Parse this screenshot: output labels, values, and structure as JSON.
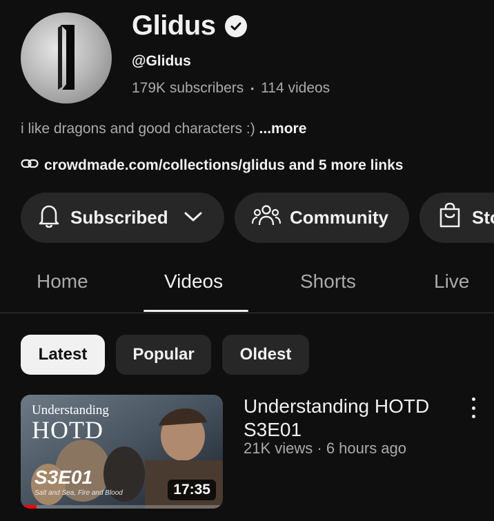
{
  "channel": {
    "name": "Glidus",
    "handle": "@Glidus",
    "subscribers": "179K subscribers",
    "separator": "•",
    "videos": "114 videos",
    "bio": "i like dragons and good characters :) ",
    "more": "...more",
    "links": "crowdmade.com/collections/glidus and 5 more links",
    "verified": true
  },
  "actions": {
    "subscribed": "Subscribed",
    "community": "Community",
    "store": "Store"
  },
  "tabs": [
    {
      "label": "Home",
      "active": false
    },
    {
      "label": "Videos",
      "active": true
    },
    {
      "label": "Shorts",
      "active": false
    },
    {
      "label": "Live",
      "active": false
    }
  ],
  "chips": [
    {
      "label": "Latest",
      "active": true
    },
    {
      "label": "Popular",
      "active": false
    },
    {
      "label": "Oldest",
      "active": false
    }
  ],
  "video": {
    "title": "Understanding HOTD S3E01",
    "meta": "21K views · 6 hours ago",
    "duration": "17:35",
    "watch_progress": 0.08,
    "thumb": {
      "top_text": "Understanding",
      "big_text": "HOTD",
      "episode": "S3E01",
      "caption": "Salt and Sea, Fire and Blood"
    }
  },
  "colors": {
    "background": "#0f0f0f",
    "surface": "#272727",
    "text": "#f1f1f1",
    "secondary_text": "#aaaaaa",
    "progress": "#ff0000"
  },
  "icons": {
    "verified": "check-badge-icon",
    "link": "link-icon",
    "bell": "bell-icon",
    "chevron": "chevron-down-icon",
    "community": "people-icon",
    "store": "shopping-bag-icon",
    "menu": "more-vert-icon"
  }
}
